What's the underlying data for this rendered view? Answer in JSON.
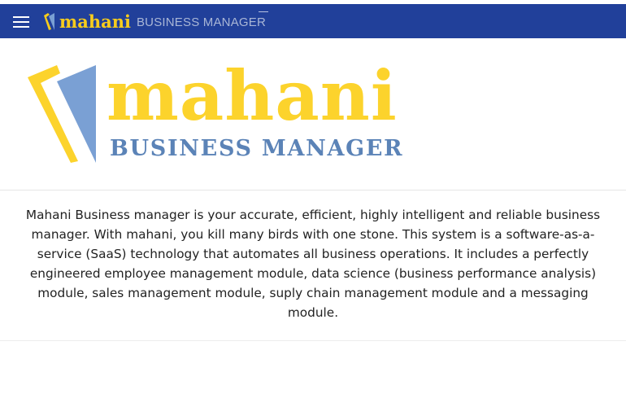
{
  "header": {
    "menu_icon": "hamburger-menu-icon",
    "logo_word": "mahani",
    "logo_subtitle": "BUSINESS MANAGER",
    "background_color": "#21409a"
  },
  "hero": {
    "logo_word": "mahani",
    "logo_subtitle": "BUSINESS MANAGER",
    "logo_word_color": "#fcd32c",
    "logo_subtitle_color": "#5b83b7"
  },
  "about": {
    "description": "Mahani Business manager is your accurate, efficient, highly intelligent and reliable business manager. With mahani, you kill many birds with one stone. This system is a software-as-a-service (SaaS) technology that automates all business operations. It includes a perfectly engineered employee management module, data science (business performance analysis) module, sales management module, suply chain management module and a messaging module."
  }
}
